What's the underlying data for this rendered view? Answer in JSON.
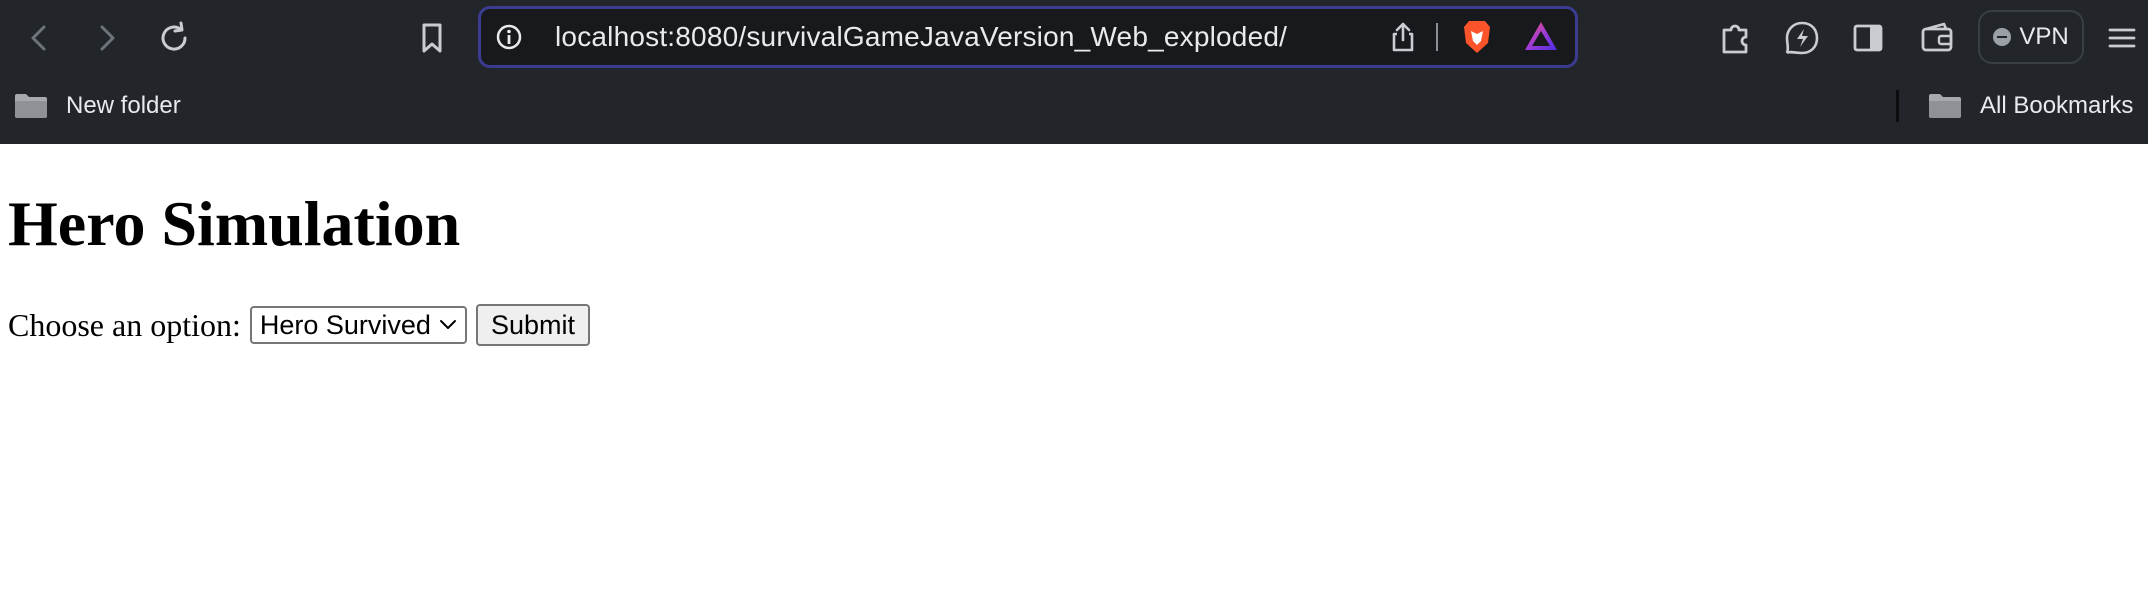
{
  "browser": {
    "url": "localhost:8080/survivalGameJavaVersion_Web_exploded/",
    "vpn_label": "VPN",
    "icons": {
      "back": "chevron-left-icon",
      "forward": "chevron-right-icon",
      "reload": "reload-icon",
      "bookmark": "bookmark-icon",
      "site_info": "info-icon",
      "share": "share-icon",
      "brave_shields": "brave-lion-icon",
      "brave_rewards": "triangle-rewards-icon",
      "extensions": "puzzle-icon",
      "leo": "leo-ai-icon",
      "sidebar": "sidebar-icon",
      "wallet": "wallet-icon",
      "menu": "hamburger-menu-icon"
    },
    "accent_color": "#3b3b8f"
  },
  "bookmarks_bar": {
    "left_folder": "New folder",
    "right_folder": "All Bookmarks"
  },
  "page": {
    "title": "Hero Simulation",
    "choose_label": "Choose an option:",
    "select_value": "Hero Survived",
    "submit_label": "Submit"
  }
}
